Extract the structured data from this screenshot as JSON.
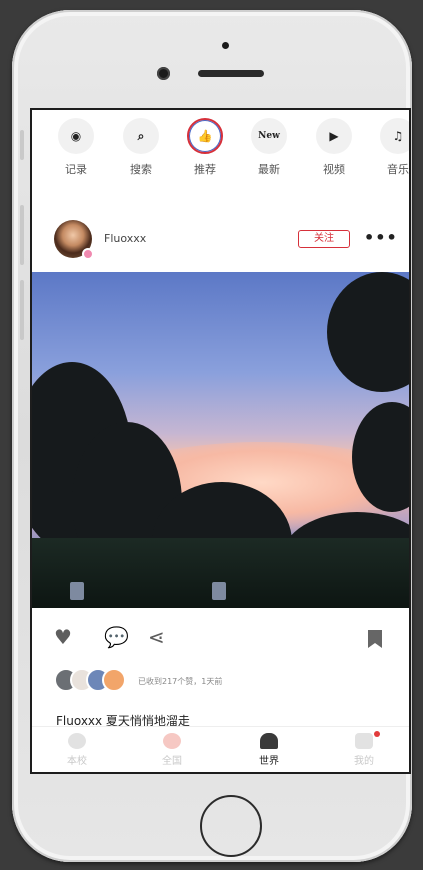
{
  "categories": [
    {
      "label": "记录",
      "icon": "camera-icon",
      "glyph": "◉"
    },
    {
      "label": "搜索",
      "icon": "search-icon",
      "glyph": "⌕"
    },
    {
      "label": "推荐",
      "icon": "thumbs-up-icon",
      "glyph": "👍"
    },
    {
      "label": "最新",
      "icon": "new-icon",
      "glyph": "New"
    },
    {
      "label": "视频",
      "icon": "video-icon",
      "glyph": "▶"
    },
    {
      "label": "音乐",
      "icon": "music-icon",
      "glyph": "♫"
    }
  ],
  "post": {
    "username": "Fluoxxx",
    "follow_label": "关注",
    "more_glyph": "•••",
    "likes_text": "已收到217个赞，1天前",
    "caption": "Fluoxxx 夏天悄悄地溜走"
  },
  "actions": {
    "heart_glyph": "♥",
    "comment_glyph": "💬",
    "share_glyph": "⋖"
  },
  "bottom_nav": [
    {
      "label": "本校",
      "icon": "school-icon",
      "active": false
    },
    {
      "label": "全国",
      "icon": "country-icon",
      "active": false
    },
    {
      "label": "世界",
      "icon": "world-icon",
      "active": true
    },
    {
      "label": "我的",
      "icon": "profile-icon",
      "active": false
    }
  ],
  "colors": {
    "accent": "#d6303a",
    "active_ring": "#4467c9",
    "notification": "#e23b3b"
  }
}
